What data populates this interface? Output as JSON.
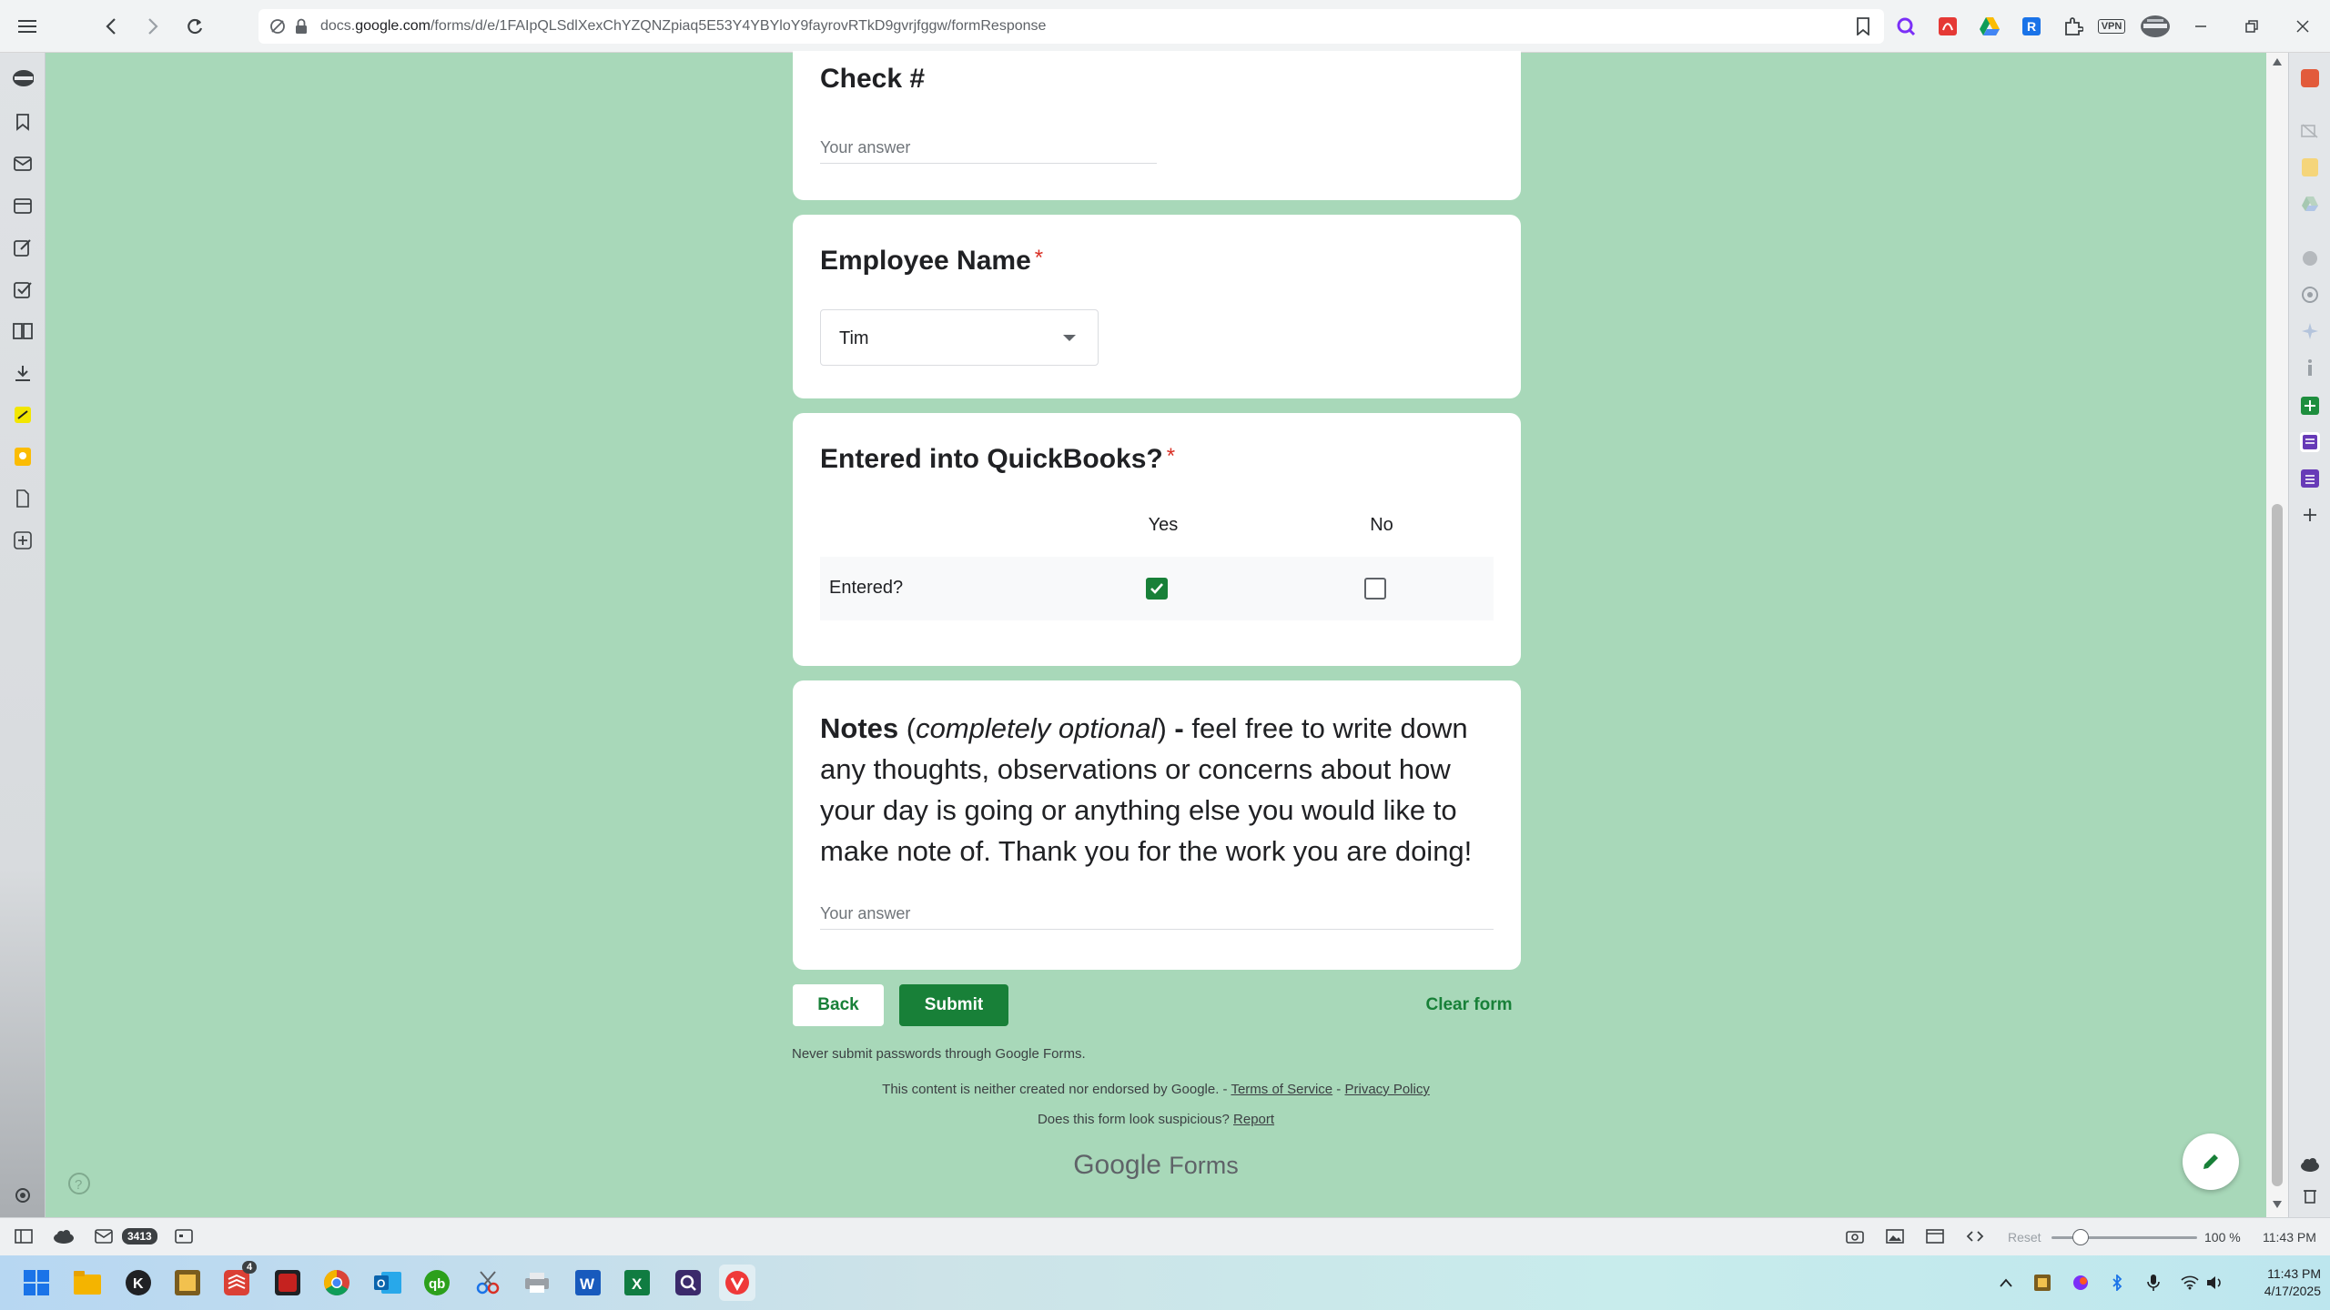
{
  "browser": {
    "url_prefix": "docs.",
    "url_host": "google.com",
    "url_path": "/forms/d/e/1FAIpQLSdlXexChYZQNZpiaq5E53Y4YBYloY9fayrovRTkD9gvrjfggw/formResponse",
    "vpn_label": "VPN"
  },
  "form": {
    "check": {
      "title": "Check #",
      "placeholder": "Your answer"
    },
    "employee": {
      "title": "Employee Name",
      "required_mark": "*",
      "selected": "Tim"
    },
    "quickbooks": {
      "title": "Entered into QuickBooks?",
      "required_mark": "*",
      "columns": [
        "Yes",
        "No"
      ],
      "row_label": "Entered?",
      "yes_checked": true,
      "no_checked": false
    },
    "notes": {
      "title_bold": "Notes",
      "paren_open": " (",
      "title_italic": "completely optional",
      "paren_close": ") ",
      "dash": "-",
      "body": " feel free to write down any thoughts, observations or concerns about how your day is going or anything else you would like to make note of. Thank you for the work you are doing!",
      "placeholder": "Your answer"
    },
    "buttons": {
      "back": "Back",
      "submit": "Submit",
      "clear": "Clear form"
    },
    "footer": {
      "warning": "Never submit passwords through Google Forms.",
      "disclaimer": "This content is neither created nor endorsed by Google. - ",
      "terms": "Terms of Service",
      "separator": " - ",
      "privacy": "Privacy Policy",
      "suspicious": "Does this form look suspicious? ",
      "report": "Report",
      "logo_google": "Google",
      "logo_forms": "Forms"
    }
  },
  "statusbar": {
    "mail_count": "3413",
    "reset": "Reset",
    "zoom": "100 %",
    "time": "11:43 PM",
    "zoom_level": 0.2
  },
  "taskbar": {
    "time": "11:43 PM",
    "date": "4/17/2025",
    "badge_count": "4"
  },
  "colors": {
    "background": "#a8d8b9",
    "accent_green": "#188038",
    "required_red": "#d93025"
  }
}
